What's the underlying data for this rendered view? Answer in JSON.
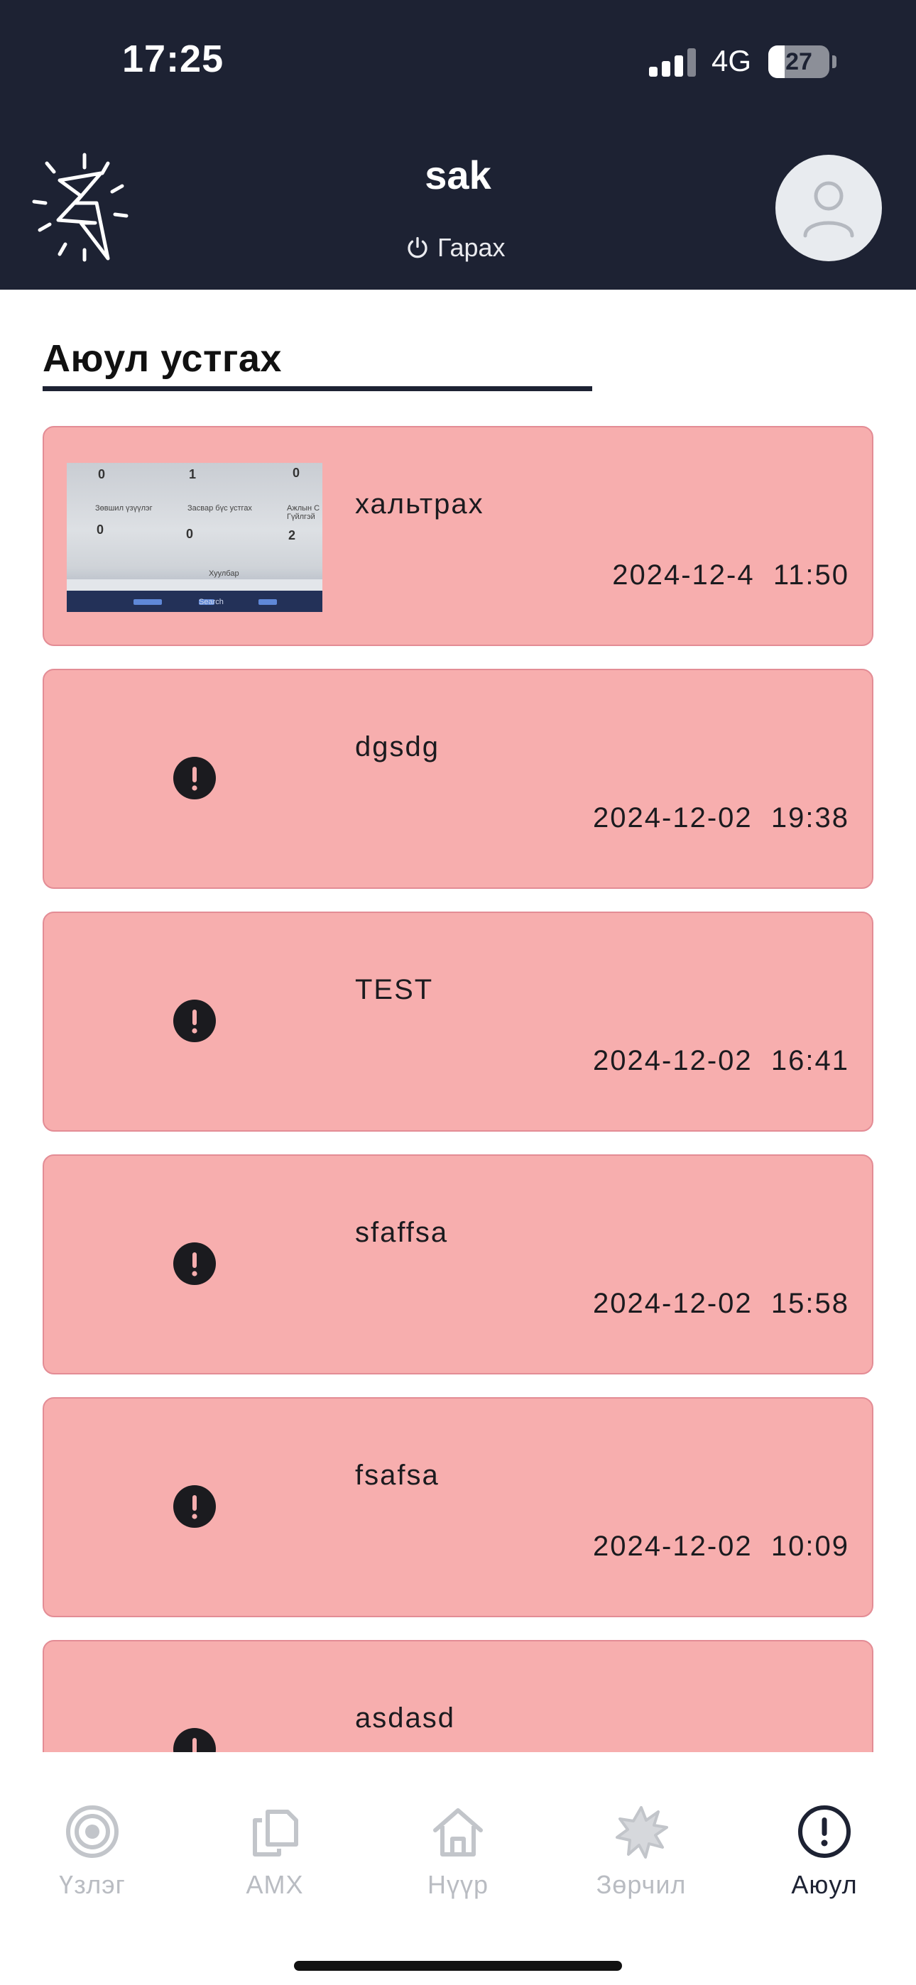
{
  "status_bar": {
    "time": "17:25",
    "network": "4G",
    "battery": "27",
    "battery_level": 0.27
  },
  "header": {
    "user_name": "sak",
    "logout_label": "Гарах",
    "logo_icon": "lightning-burst-icon",
    "avatar_icon": "user-icon"
  },
  "page": {
    "title": "Аюул устгах"
  },
  "cards": [
    {
      "title": "хальтрах",
      "date": "2024-12-4",
      "time": "11:50",
      "has_photo": true,
      "thumb": {
        "n1": "0",
        "n2": "1",
        "n3": "0",
        "l1": "Зөвшил үзүүлэг",
        "l2": "Засвар бүс устгах",
        "l3": "Ажлын С Гүйлгэй",
        "n4": "0",
        "n5": "0",
        "n6": "2",
        "footer": "Хуулбар",
        "search": "Search"
      }
    },
    {
      "title": "dgsdg",
      "date": "2024-12-02",
      "time": "19:38",
      "has_photo": false
    },
    {
      "title": "TEST",
      "date": "2024-12-02",
      "time": "16:41",
      "has_photo": false
    },
    {
      "title": "sfaffsa",
      "date": "2024-12-02",
      "time": "15:58",
      "has_photo": false
    },
    {
      "title": "fsafsa",
      "date": "2024-12-02",
      "time": "10:09",
      "has_photo": false
    },
    {
      "title": "asdasd",
      "date": "",
      "time": "",
      "has_photo": false
    }
  ],
  "nav": {
    "items": [
      {
        "label": "Үзлэг",
        "icon": "target-icon"
      },
      {
        "label": "АМХ",
        "icon": "copy-icon"
      },
      {
        "label": "Нүүр",
        "icon": "home-icon"
      },
      {
        "label": "Зөрчил",
        "icon": "burst-icon"
      },
      {
        "label": "Аюул",
        "icon": "alert-circle-icon",
        "active": true
      }
    ]
  },
  "colors": {
    "header_bg": "#1d2233",
    "card_bg": "#f7aeae",
    "card_border": "#e38c95",
    "nav_inactive": "#b9bcc2",
    "nav_active": "#1d2233"
  }
}
